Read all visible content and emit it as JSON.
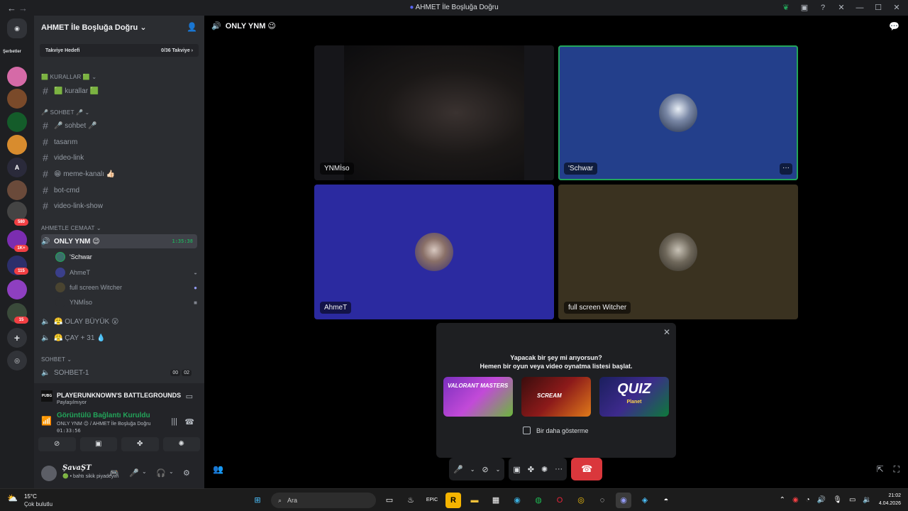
{
  "window": {
    "title": "AHMET İle Boşluğa Doğru",
    "back": "←",
    "fwd": "→"
  },
  "titlebar_icons": [
    "leaf-icon",
    "inbox-icon",
    "help-icon",
    "tools-icon",
    "minimize-icon",
    "maximize-icon",
    "close-icon"
  ],
  "servers": {
    "folder_label": "Şerbetler",
    "badges": [
      "580",
      "1K+",
      "115",
      "15"
    ]
  },
  "guild": {
    "name": "AHMET İle Boşluğa Doğru ⌄",
    "boost_label": "Takviye Hedefi",
    "boost_value": "0/36 Takviye ›"
  },
  "channels": {
    "cat1": "🟩 KURALLAR 🟩 ⌄",
    "ch_kurallar": "🟩 kurallar 🟩",
    "cat2": "🎤 SOHBET 🎤 ⌄",
    "ch_sohbet": "🎤 sohbet 🎤",
    "ch_tasarim": "tasarım",
    "ch_videolink": "video-link",
    "ch_meme": "😁 meme-kanalı 👍🏻",
    "ch_botcmd": "bot-cmd",
    "ch_videolinkshow": "video-link-show",
    "cat3": "AHMETLE CEMAAT ⌄",
    "voice_active": "ONLY YNM 😉",
    "voice_time": "1:35:38",
    "users": [
      "'Schwar",
      "AhmeT",
      "full screen Witcher",
      "YNMİso"
    ],
    "voice_olay": "😤 OLAY BÜYÜK 😮",
    "voice_cay": "😤 ÇAY + 31 💧",
    "cat4": "SOHBET ⌄",
    "voice_sohbet1": "SOHBET-1",
    "sohbet1_counts": [
      "00",
      "02"
    ]
  },
  "activity_panel": {
    "game_icon": "PUBG",
    "game_title": "PLAYERUNKNOWN'S BATTLEGROUNDS",
    "game_sub": "Paylaşılmıyor",
    "conn_title": "Görüntülü Bağlantı Kuruldu",
    "conn_sub": "ONLY YNM 😉 / AHMET İle Boşluğa Doğru",
    "conn_time": "01:33:56"
  },
  "userbar": {
    "name": "ŞavaŞT",
    "status": "🟢 • bahtı sikik piyadeyim"
  },
  "main": {
    "channel_title": "ONLY YNM 😉",
    "tiles": [
      {
        "name": "YNMİso"
      },
      {
        "name": "'Schwar"
      },
      {
        "name": "AhmeT"
      },
      {
        "name": "full screen Witcher"
      }
    ],
    "more_label": "···"
  },
  "popup": {
    "line1": "Yapacak bir şey mi arıyorsun?",
    "line2": "Hemen bir oyun veya video oynatma listesi başlat.",
    "activities": [
      "VALORANT MASTERS",
      "SCREAM",
      "QUIZ"
    ],
    "quiz_sub": "Planet",
    "checkbox_label": "Bir daha gösterme",
    "close": "✕"
  },
  "taskbar": {
    "temp": "15°C",
    "weather": "Çok bulutlu",
    "search_placeholder": "Ara",
    "time": "21:02",
    "date": "4.04.2026"
  },
  "colors": {
    "accent": "#5865f2",
    "green": "#23a55a",
    "danger": "#da373c",
    "tile_schwar": "#233f8b",
    "tile_ahmet": "#2b2aa0",
    "tile_witcher": "#3a3220",
    "tile_ynm": "#16161a"
  }
}
